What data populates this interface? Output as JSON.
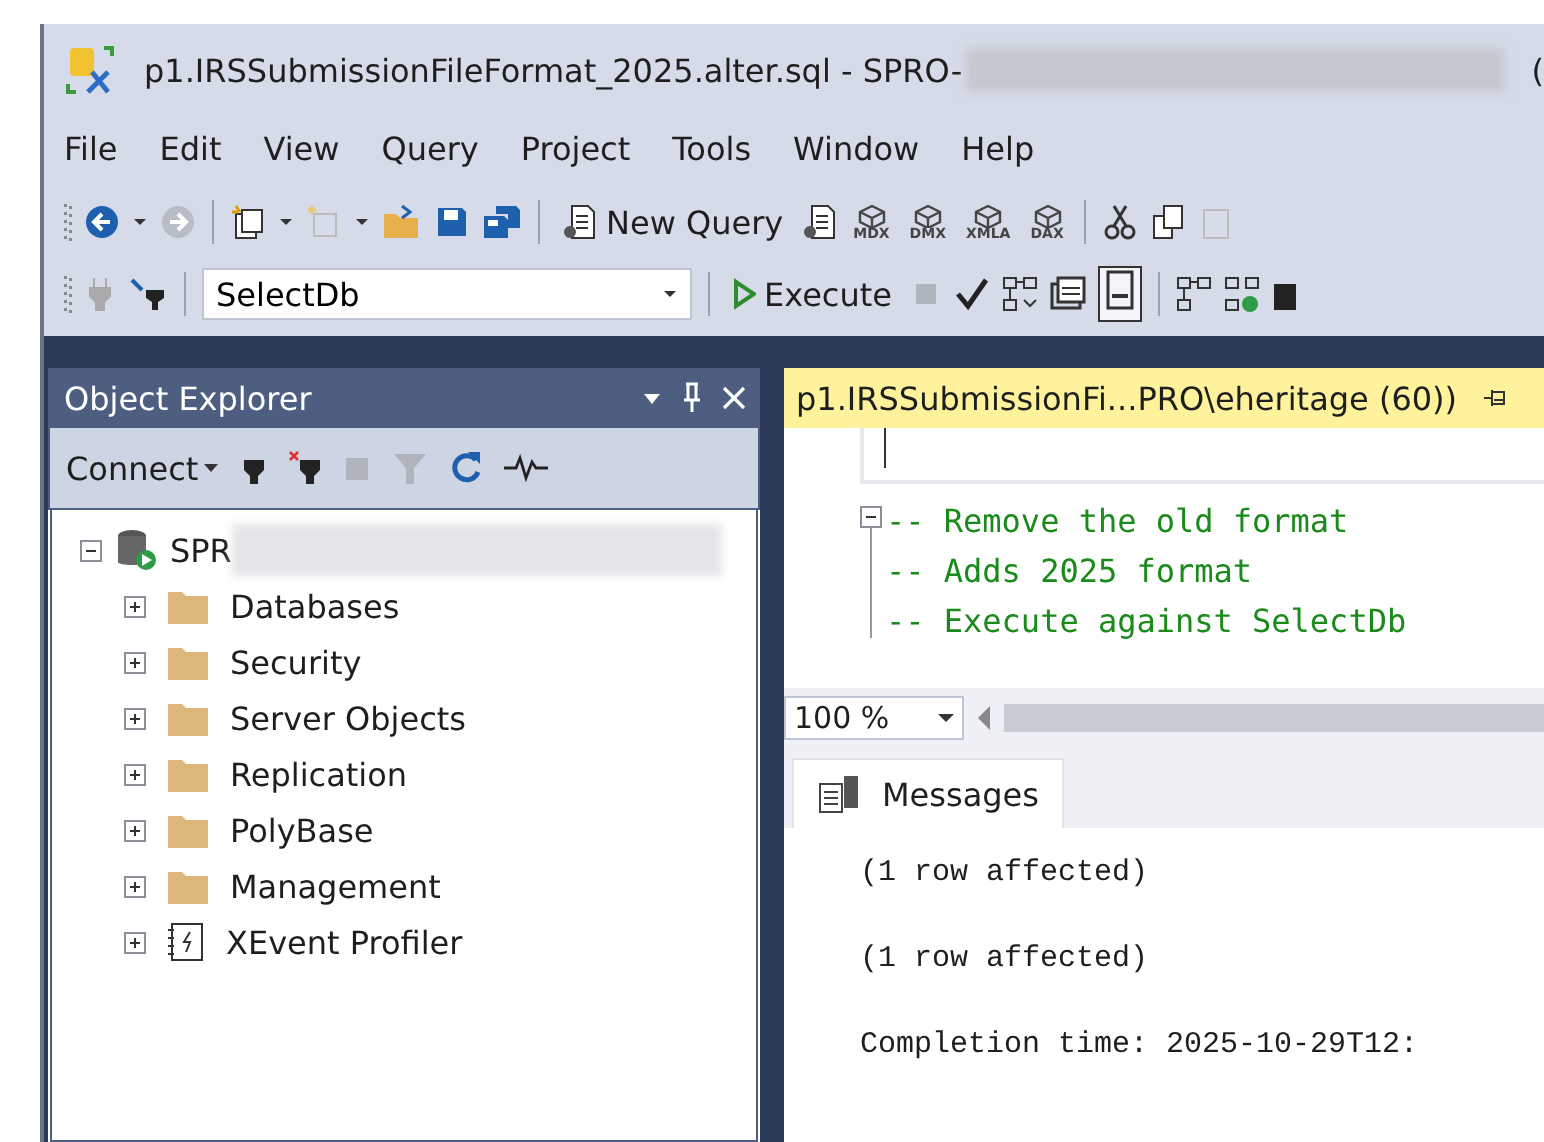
{
  "window": {
    "title": "p1.IRSSubmissionFileFormat_2025.alter.sql - SPRO-",
    "title_tail": "("
  },
  "menu": [
    "File",
    "Edit",
    "View",
    "Query",
    "Project",
    "Tools",
    "Window",
    "Help"
  ],
  "toolbar": {
    "new_query": "New Query",
    "query_types": [
      "MDX",
      "DMX",
      "XMLA",
      "DAX"
    ]
  },
  "sql_toolbar": {
    "database": "SelectDb",
    "execute": "Execute"
  },
  "object_explorer": {
    "title": "Object Explorer",
    "connect": "Connect",
    "tree": {
      "label": "SPR",
      "expanded": true,
      "children": [
        {
          "label": "Databases",
          "kind": "folder",
          "expanded": false
        },
        {
          "label": "Security",
          "kind": "folder",
          "expanded": false
        },
        {
          "label": "Server Objects",
          "kind": "folder",
          "expanded": false
        },
        {
          "label": "Replication",
          "kind": "folder",
          "expanded": false
        },
        {
          "label": "PolyBase",
          "kind": "folder",
          "expanded": false
        },
        {
          "label": "Management",
          "kind": "folder",
          "expanded": false
        },
        {
          "label": "XEvent Profiler",
          "kind": "profiler",
          "expanded": false
        }
      ]
    }
  },
  "editor": {
    "tab": "p1.IRSSubmissionFi...PRO\\eheritage (60))",
    "block_expanded": true,
    "lines": [
      "-- Remove the old format",
      "-- Adds 2025 format",
      "-- Execute against SelectDb"
    ],
    "zoom": "100 %"
  },
  "results": {
    "tab": "Messages",
    "messages": [
      "(1 row affected)",
      "(1 row affected)",
      "Completion time: 2025-10-29T12:"
    ]
  }
}
